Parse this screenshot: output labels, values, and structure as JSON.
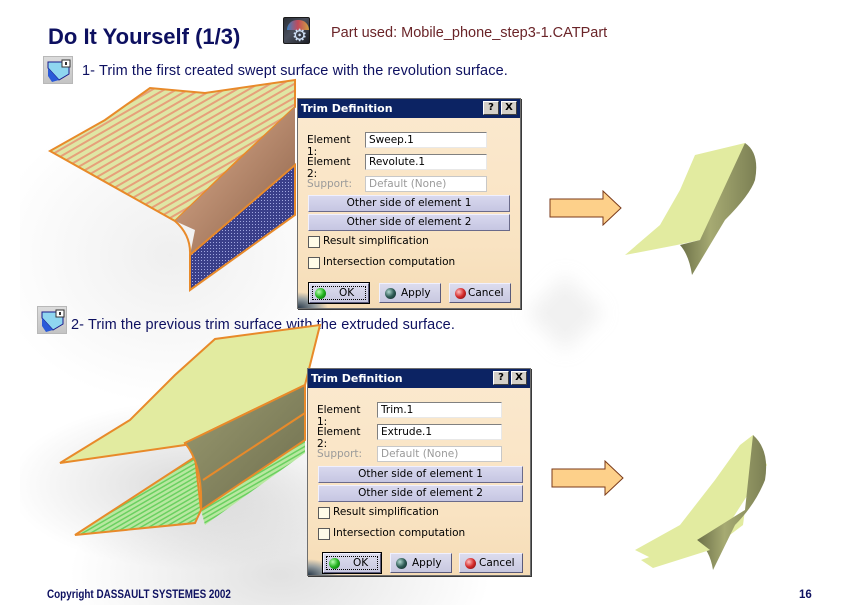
{
  "slide": {
    "title": "Do It Yourself (1/3)",
    "part_used": "Part used: Mobile_phone_step3-1.CATPart",
    "app_icon": "generative-shape-design-workbench-icon",
    "copyright": "Copyright DASSAULT SYSTEMES 2002",
    "page_number": "16"
  },
  "steps": [
    {
      "icon": "trim-tool-icon",
      "text": "1- Trim the first created swept surface with the revolution surface.",
      "dialog": {
        "title": "Trim Definition",
        "help_label": "?",
        "close_label": "X",
        "element1_label": "Element 1:",
        "element1_value": "Sweep.1",
        "element2_label": "Element 2:",
        "element2_value": "Revolute.1",
        "support_label": "Support:",
        "support_value": "Default (None)",
        "other_side1_label": "Other side of element 1",
        "other_side2_label": "Other side of element 2",
        "result_simplification_label": "Result simplification",
        "result_simplification_checked": false,
        "intersection_computation_label": "Intersection computation",
        "intersection_computation_checked": false,
        "ok_label": "OK",
        "apply_label": "Apply",
        "cancel_label": "Cancel"
      }
    },
    {
      "icon": "trim-tool-icon",
      "text": "2- Trim the previous trim surface with the extruded surface.",
      "dialog": {
        "title": "Trim Definition",
        "help_label": "?",
        "close_label": "X",
        "element1_label": "Element 1:",
        "element1_value": "Trim.1",
        "element2_label": "Element 2:",
        "element2_value": "Extrude.1",
        "support_label": "Support:",
        "support_value": "Default (None)",
        "other_side1_label": "Other side of element 1",
        "other_side2_label": "Other side of element 2",
        "result_simplification_label": "Result simplification",
        "result_simplification_checked": false,
        "intersection_computation_label": "Intersection computation",
        "intersection_computation_checked": false,
        "ok_label": "OK",
        "apply_label": "Apply",
        "cancel_label": "Cancel"
      }
    }
  ],
  "colors": {
    "title_text": "#0d1060",
    "part_used_text": "#6a2428",
    "dialog_titlebar": "#0c2363",
    "dialog_body": "#fbe9cf",
    "surface_yellow": "#e2eba0",
    "surface_edge": "#e88a2a",
    "arrow_fill": "#fdd08a"
  }
}
